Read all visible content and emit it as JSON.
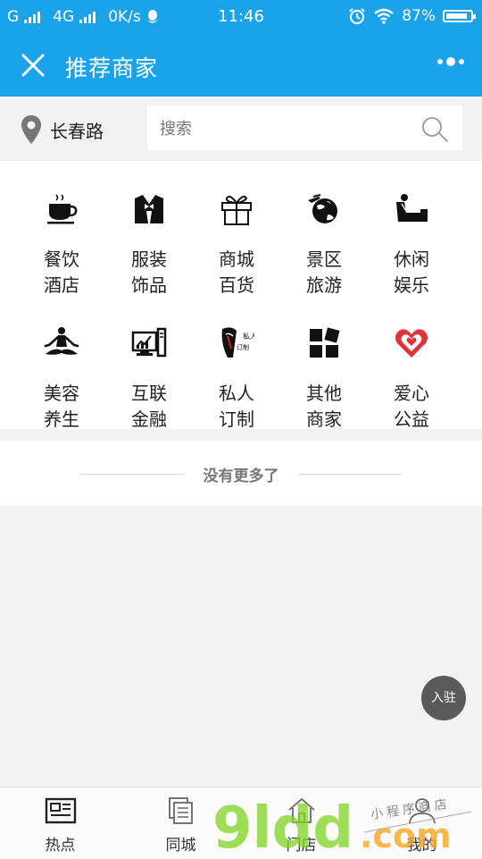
{
  "statusbar": {
    "carrier1": "G",
    "carrier2": "4G",
    "speed": "0K/s",
    "time": "11:46",
    "battery": "87%"
  },
  "header": {
    "title": "推荐商家",
    "more_icon": "more-dots-icon",
    "close_icon": "close-icon"
  },
  "search": {
    "location": "长春路",
    "placeholder": "搜索"
  },
  "categories": [
    {
      "line1": "餐饮",
      "line2": "酒店",
      "icon": "coffee-cup-icon"
    },
    {
      "line1": "服装",
      "line2": "饰品",
      "icon": "tuxedo-icon"
    },
    {
      "line1": "商城",
      "line2": "百货",
      "icon": "gift-box-icon"
    },
    {
      "line1": "景区",
      "line2": "旅游",
      "icon": "globe-travel-icon"
    },
    {
      "line1": "休闲",
      "line2": "娱乐",
      "icon": "armchair-icon"
    },
    {
      "line1": "美容",
      "line2": "养生",
      "icon": "yoga-icon"
    },
    {
      "line1": "互联",
      "line2": "金融",
      "icon": "computer-chart-icon"
    },
    {
      "line1": "私人",
      "line2": "订制",
      "icon": "custom-tailor-icon",
      "icon_text1": "私人",
      "icon_text2": "订制"
    },
    {
      "line1": "其他",
      "line2": "商家",
      "icon": "app-grid-icon"
    },
    {
      "line1": "爱心",
      "line2": "公益",
      "icon": "charity-heart-icon"
    }
  ],
  "list_end_text": "没有更多了",
  "join_button": "入驻",
  "tabs": [
    {
      "label": "热点",
      "icon": "newspaper-icon"
    },
    {
      "label": "同城",
      "icon": "documents-icon"
    },
    {
      "label": "门店",
      "icon": "store-home-icon"
    },
    {
      "label": "我的",
      "icon": "user-icon"
    }
  ],
  "watermark": {
    "main": "9ldd",
    "suffix": ".com",
    "tagline": "小程序商店"
  },
  "colors": {
    "brand_blue": "#1aa3e8",
    "charity_red": "#e0343a",
    "watermark_green": "#7ed321",
    "watermark_orange": "#f5a623"
  }
}
